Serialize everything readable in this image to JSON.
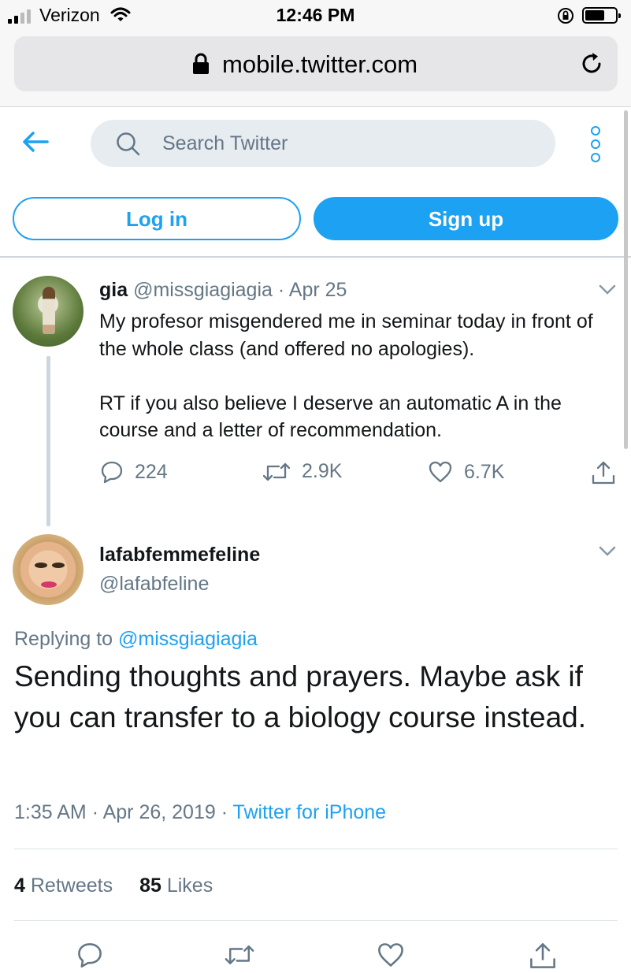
{
  "status_bar": {
    "carrier": "Verizon",
    "time": "12:46 PM"
  },
  "browser": {
    "url": "mobile.twitter.com"
  },
  "header": {
    "search_placeholder": "Search Twitter",
    "login_label": "Log in",
    "signup_label": "Sign up",
    "accent_color": "#1da1f2"
  },
  "tweet": {
    "name": "gia",
    "handle": "@missgiagiagia",
    "separator": "·",
    "date": "Apr 25",
    "text_line1": "My profesor misgendered me in seminar today in front of the whole class (and offered no apologies).",
    "text_line2": "RT if you also believe I deserve an automatic A in the course and a letter of recommendation.",
    "replies": "224",
    "retweets": "2.9K",
    "likes": "6.7K"
  },
  "reply": {
    "name": "lafabfemmefeline",
    "handle": "@lafabfeline",
    "replying_prefix": "Replying to",
    "replying_to": "@missgiagiagia",
    "text": "Sending thoughts and prayers. Maybe ask if you can transfer to a biology course instead.",
    "time": "1:35 AM",
    "date": "Apr 26, 2019",
    "source": "Twitter for iPhone",
    "retweet_count": "4",
    "retweet_label": "Retweets",
    "like_count": "85",
    "like_label": "Likes"
  },
  "icons": [
    "signal-icon",
    "wifi-icon",
    "rotation-lock-icon",
    "battery-icon",
    "lock-icon",
    "reload-icon",
    "back-arrow-icon",
    "search-icon",
    "more-icon",
    "chevron-down-icon",
    "reply-icon",
    "retweet-icon",
    "like-icon",
    "share-icon"
  ]
}
